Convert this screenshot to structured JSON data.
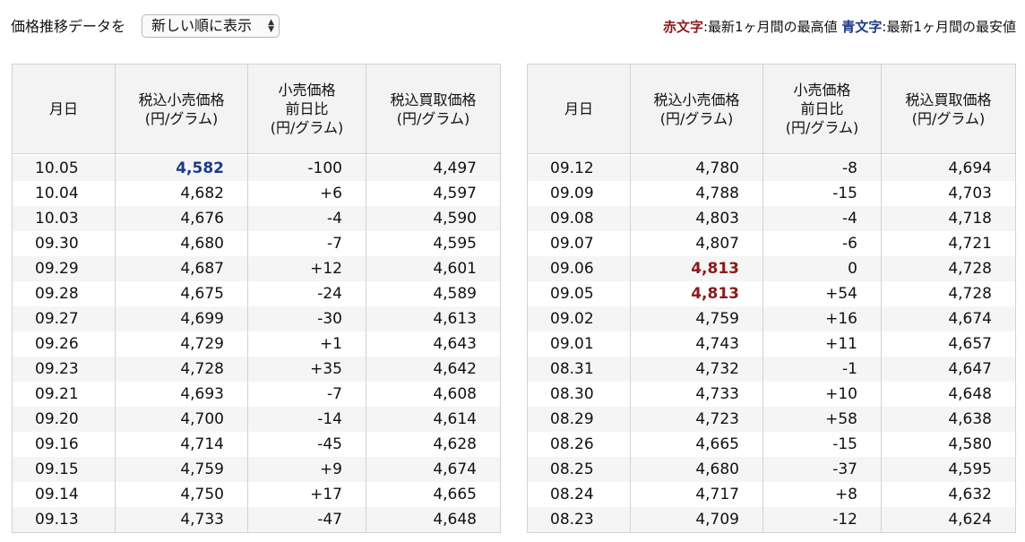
{
  "controls": {
    "sort_label": "価格推移データを",
    "sort_selected": "新しい順に表示"
  },
  "legend": {
    "red_term": "赤文字",
    "red_desc": ":最新1ヶ月間の最高値",
    "blue_term": "青文字",
    "blue_desc": ":最新1ヶ月間の最安値"
  },
  "colors": {
    "high": "#8a1b1b",
    "low": "#1c3a8a"
  },
  "headers": {
    "date": "月日",
    "retail": [
      "税込小売価格",
      "(円/グラム)"
    ],
    "change": [
      "小売価格",
      "前日比",
      "(円/グラム)"
    ],
    "buy": [
      "税込買取価格",
      "(円/グラム)"
    ]
  },
  "tables": [
    {
      "rows": [
        {
          "date": "10.05",
          "retail": "4,582",
          "change": "-100",
          "buy": "4,497",
          "mark": "low"
        },
        {
          "date": "10.04",
          "retail": "4,682",
          "change": "+6",
          "buy": "4,597"
        },
        {
          "date": "10.03",
          "retail": "4,676",
          "change": "-4",
          "buy": "4,590"
        },
        {
          "date": "09.30",
          "retail": "4,680",
          "change": "-7",
          "buy": "4,595"
        },
        {
          "date": "09.29",
          "retail": "4,687",
          "change": "+12",
          "buy": "4,601"
        },
        {
          "date": "09.28",
          "retail": "4,675",
          "change": "-24",
          "buy": "4,589"
        },
        {
          "date": "09.27",
          "retail": "4,699",
          "change": "-30",
          "buy": "4,613"
        },
        {
          "date": "09.26",
          "retail": "4,729",
          "change": "+1",
          "buy": "4,643"
        },
        {
          "date": "09.23",
          "retail": "4,728",
          "change": "+35",
          "buy": "4,642"
        },
        {
          "date": "09.21",
          "retail": "4,693",
          "change": "-7",
          "buy": "4,608"
        },
        {
          "date": "09.20",
          "retail": "4,700",
          "change": "-14",
          "buy": "4,614"
        },
        {
          "date": "09.16",
          "retail": "4,714",
          "change": "-45",
          "buy": "4,628"
        },
        {
          "date": "09.15",
          "retail": "4,759",
          "change": "+9",
          "buy": "4,674"
        },
        {
          "date": "09.14",
          "retail": "4,750",
          "change": "+17",
          "buy": "4,665"
        },
        {
          "date": "09.13",
          "retail": "4,733",
          "change": "-47",
          "buy": "4,648"
        }
      ]
    },
    {
      "rows": [
        {
          "date": "09.12",
          "retail": "4,780",
          "change": "-8",
          "buy": "4,694"
        },
        {
          "date": "09.09",
          "retail": "4,788",
          "change": "-15",
          "buy": "4,703"
        },
        {
          "date": "09.08",
          "retail": "4,803",
          "change": "-4",
          "buy": "4,718"
        },
        {
          "date": "09.07",
          "retail": "4,807",
          "change": "-6",
          "buy": "4,721"
        },
        {
          "date": "09.06",
          "retail": "4,813",
          "change": "0",
          "buy": "4,728",
          "mark": "high"
        },
        {
          "date": "09.05",
          "retail": "4,813",
          "change": "+54",
          "buy": "4,728",
          "mark": "high"
        },
        {
          "date": "09.02",
          "retail": "4,759",
          "change": "+16",
          "buy": "4,674"
        },
        {
          "date": "09.01",
          "retail": "4,743",
          "change": "+11",
          "buy": "4,657"
        },
        {
          "date": "08.31",
          "retail": "4,732",
          "change": "-1",
          "buy": "4,647"
        },
        {
          "date": "08.30",
          "retail": "4,733",
          "change": "+10",
          "buy": "4,648"
        },
        {
          "date": "08.29",
          "retail": "4,723",
          "change": "+58",
          "buy": "4,638"
        },
        {
          "date": "08.26",
          "retail": "4,665",
          "change": "-15",
          "buy": "4,580"
        },
        {
          "date": "08.25",
          "retail": "4,680",
          "change": "-37",
          "buy": "4,595"
        },
        {
          "date": "08.24",
          "retail": "4,717",
          "change": "+8",
          "buy": "4,632"
        },
        {
          "date": "08.23",
          "retail": "4,709",
          "change": "-12",
          "buy": "4,624"
        }
      ]
    }
  ]
}
